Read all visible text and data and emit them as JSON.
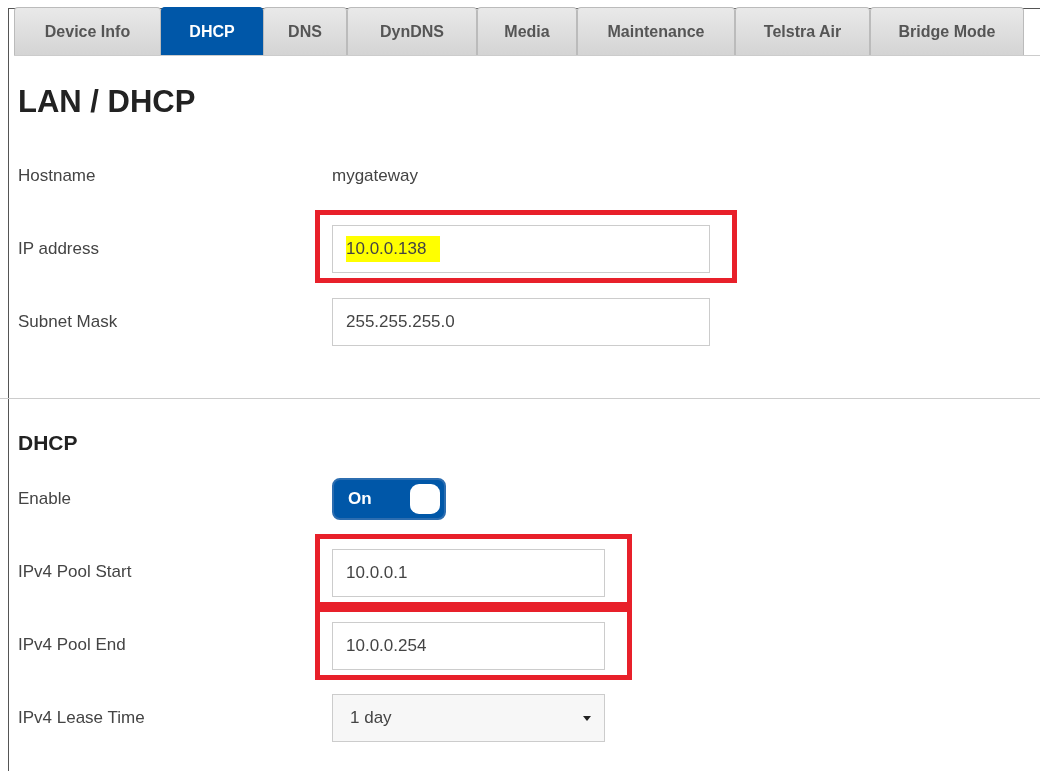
{
  "tabs": [
    {
      "label": "Device Info",
      "selected": false
    },
    {
      "label": "DHCP",
      "selected": true
    },
    {
      "label": "DNS",
      "selected": false
    },
    {
      "label": "DynDNS",
      "selected": false
    },
    {
      "label": "Media",
      "selected": false
    },
    {
      "label": "Maintenance",
      "selected": false
    },
    {
      "label": "Telstra Air",
      "selected": false
    },
    {
      "label": "Bridge Mode",
      "selected": false
    }
  ],
  "title": "LAN / DHCP",
  "lan_rows": [
    {
      "kind": "text",
      "label": "Hostname",
      "value": "mygateway"
    },
    {
      "kind": "field",
      "label": "IP address",
      "value": "10.0.0.138",
      "highlighted": true,
      "text_selected": true,
      "wide": true
    },
    {
      "kind": "field",
      "label": "Subnet Mask",
      "value": "255.255.255.0",
      "highlighted": false,
      "text_selected": false,
      "wide": true
    }
  ],
  "dhcp_heading": "DHCP",
  "dhcp_rows": [
    {
      "kind": "toggle",
      "label": "Enable",
      "value": "On",
      "on": true
    },
    {
      "kind": "field",
      "label": "IPv4 Pool Start",
      "value": "10.0.0.1",
      "highlighted": true,
      "text_selected": false,
      "wide": false
    },
    {
      "kind": "field",
      "label": "IPv4 Pool End",
      "value": "10.0.0.254",
      "highlighted": true,
      "text_selected": false,
      "wide": false
    },
    {
      "kind": "select",
      "label": "IPv4 Lease Time",
      "value": "1 day"
    }
  ]
}
